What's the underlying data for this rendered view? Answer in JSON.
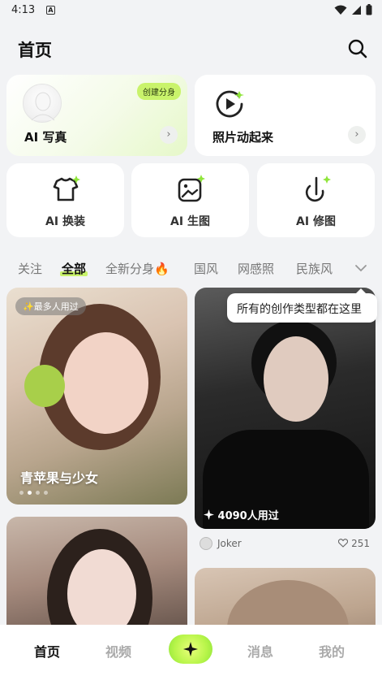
{
  "status_bar": {
    "time": "4:13",
    "notification_icon": "A"
  },
  "header": {
    "title": "首页"
  },
  "big_cards": [
    {
      "label": "AI 写真",
      "badge": "创建分身"
    },
    {
      "label": "照片动起来"
    }
  ],
  "small_cards": [
    {
      "label": "AI 换装"
    },
    {
      "label": "AI 生图"
    },
    {
      "label": "AI 修图"
    }
  ],
  "tabs": [
    {
      "label": "关注",
      "active": false
    },
    {
      "label": "全部",
      "active": true
    },
    {
      "label": "全新分身🔥",
      "active": false
    },
    {
      "label": "国风",
      "active": false
    },
    {
      "label": "网感照",
      "active": false
    },
    {
      "label": "民族风",
      "active": false
    }
  ],
  "tooltip": "所有的创作类型都在这里",
  "feed": {
    "card1": {
      "tag": "✨最多人用过",
      "caption": "青苹果与少女"
    },
    "card2": {
      "used": "4090人用过",
      "author": "Joker",
      "likes": "251"
    }
  },
  "bottom_nav": [
    {
      "label": "首页",
      "active": true
    },
    {
      "label": "视频",
      "active": false
    },
    {
      "label": "消息",
      "active": false
    },
    {
      "label": "我的",
      "active": false
    }
  ],
  "colors": {
    "accent": "#c9f36b",
    "background": "#f2f3f5"
  }
}
